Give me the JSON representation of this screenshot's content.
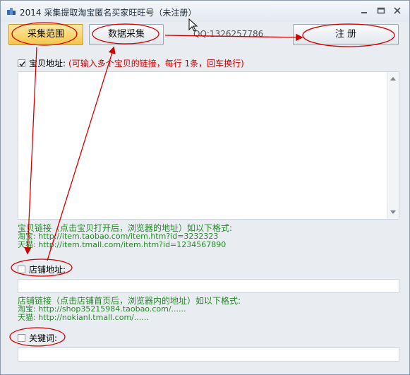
{
  "window": {
    "title": "2014 采集提取淘宝匿名买家旺旺号（未注册）"
  },
  "toolbar": {
    "collect_range_label": "采集范围",
    "data_collect_label": "数据采集",
    "qq_text": "QQ:1326257786",
    "register_label": "注  册"
  },
  "item_section": {
    "checked": true,
    "label": "宝贝地址:",
    "hint": "(可输入多个宝贝的链接，每行 1条，回车换行)",
    "format_title": "宝贝链接（点击宝贝打开后，浏览器的地址）如以下格式:",
    "example_taobao": "淘宝: http://item.taobao.com/item.htm?id=3232323",
    "example_tmall": "天猫: http://item.tmall.com/item.htm?id=1234567890"
  },
  "shop_section": {
    "checked": false,
    "label": "店铺地址:",
    "format_title": "店铺链接（点击店铺首页后，浏览器内的地址）如以下格式:",
    "example_taobao": "淘宝: http://shop35215984.taobao.com/......",
    "example_tmall": "天猫: http://nokianl.tmall.com/......"
  },
  "keyword_section": {
    "checked": false,
    "label": "关键词:"
  },
  "colors": {
    "annotation_red": "#d40000",
    "hint_red": "#d10000",
    "format_green": "#228b22",
    "active_button": "#f6c64a"
  }
}
